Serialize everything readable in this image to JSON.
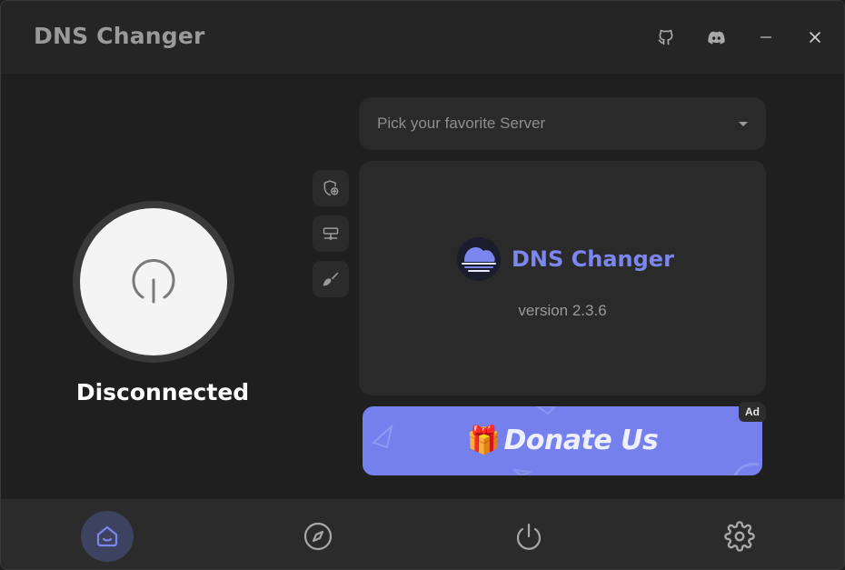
{
  "window": {
    "title": "DNS Changer",
    "controls": {
      "github_icon": "github-icon",
      "discord_icon": "discord-icon",
      "minimize_icon": "minimize-icon",
      "close_icon": "close-icon"
    }
  },
  "connection": {
    "status": "Disconnected",
    "power_icon": "power-icon"
  },
  "tools": [
    {
      "icon": "shield-add-icon"
    },
    {
      "icon": "network-server-icon"
    },
    {
      "icon": "broom-icon"
    }
  ],
  "server_picker": {
    "placeholder": "Pick your favorite Server"
  },
  "info_card": {
    "title": "DNS Changer",
    "version": "version 2.3.6"
  },
  "donate_banner": {
    "emoji": "🎁",
    "label": "Donate Us",
    "badge": "Ad"
  },
  "bottom_nav": {
    "items": [
      {
        "icon": "home-icon",
        "active": true
      },
      {
        "icon": "compass-icon",
        "active": false
      },
      {
        "icon": "power-icon",
        "active": false
      },
      {
        "icon": "gear-icon",
        "active": false
      }
    ]
  },
  "colors": {
    "accent": "#7580ec",
    "title_accent": "#7b86ee",
    "background": "#1f1f1f",
    "panel": "#2a2a2a"
  }
}
